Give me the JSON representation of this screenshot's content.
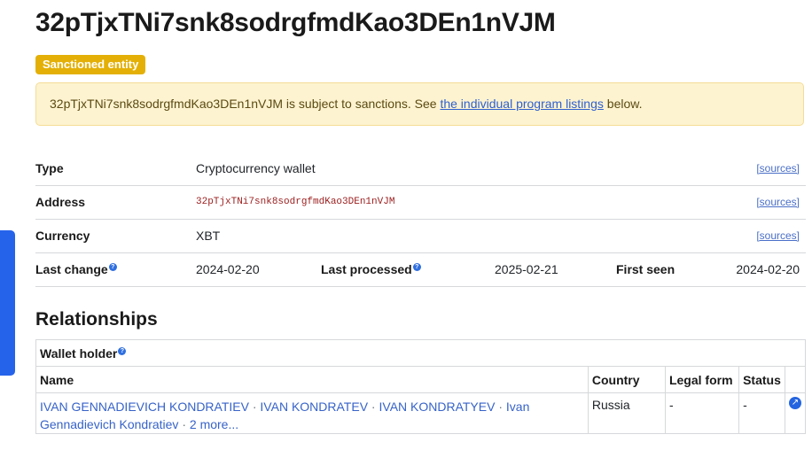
{
  "entity": {
    "title": "32pTjxTNi7snk8sodrgfmdKao3DEn1nVJM",
    "badge": "Sanctioned entity"
  },
  "alert": {
    "prefix": "32pTjxTNi7snk8sodrgfmdKao3DEn1nVJM is subject to sanctions. See ",
    "link_text": "the individual program listings",
    "suffix": " below."
  },
  "properties": {
    "type": {
      "label": "Type",
      "value": "Cryptocurrency wallet",
      "sources": "[sources]"
    },
    "address": {
      "label": "Address",
      "value": "32pTjxTNi7snk8sodrgfmdKao3DEn1nVJM",
      "sources": "[sources]"
    },
    "currency": {
      "label": "Currency",
      "value": "XBT",
      "sources": "[sources]"
    },
    "dates": {
      "last_change_label": "Last change",
      "last_change_value": "2024-02-20",
      "last_processed_label": "Last processed",
      "last_processed_value": "2025-02-21",
      "first_seen_label": "First seen",
      "first_seen_value": "2024-02-20"
    }
  },
  "relationships": {
    "title": "Relationships",
    "caption": "Wallet holder",
    "headers": {
      "name": "Name",
      "country": "Country",
      "legal_form": "Legal form",
      "status": "Status"
    },
    "rows": [
      {
        "names": [
          "IVAN GENNADIEVICH KONDRATIEV",
          "IVAN KONDRATEV",
          "IVAN KONDRATYEV",
          "Ivan Gennadievich Kondratiev"
        ],
        "more": "2 more...",
        "country": "Russia",
        "legal_form": "-",
        "status": "-"
      }
    ]
  },
  "help_glyph": "?",
  "separator": " · ",
  "icons": {
    "external_link": "external-link-icon",
    "help": "help-icon"
  },
  "colors": {
    "badge": "#e4b007",
    "alert_bg": "#fdf3d0",
    "link": "#3763c8",
    "accent": "#2563eb"
  }
}
